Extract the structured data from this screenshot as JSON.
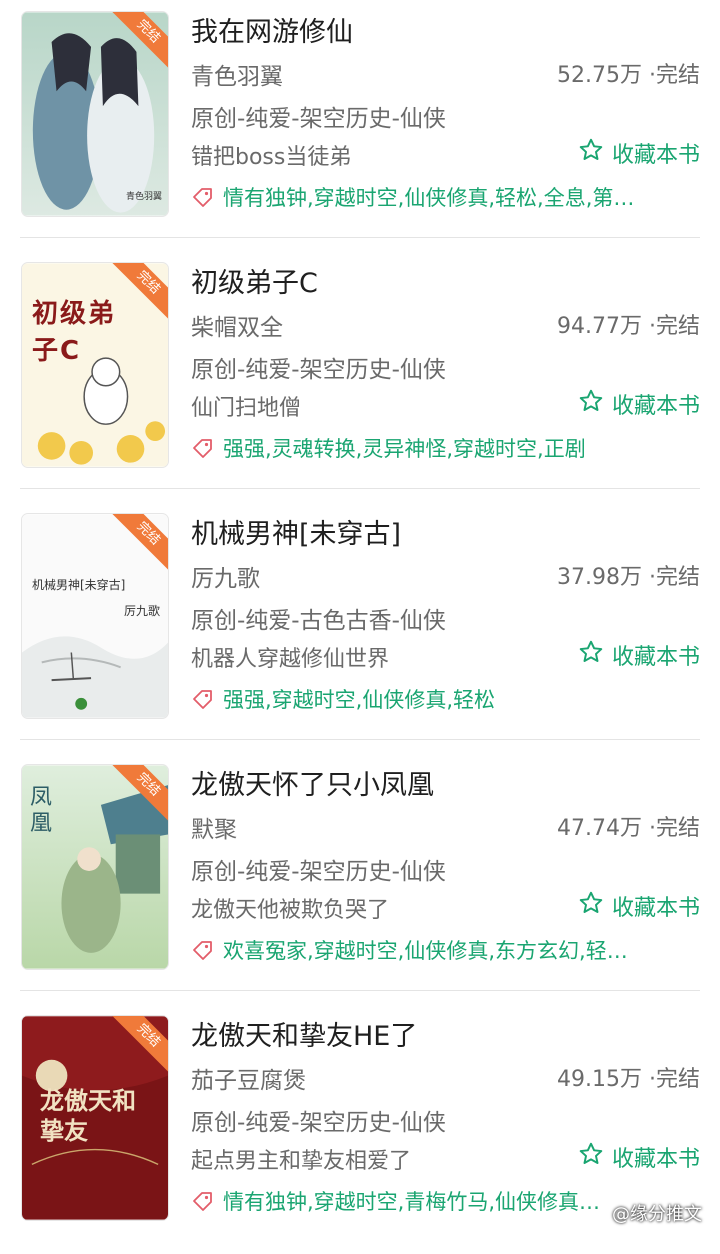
{
  "colors": {
    "accent": "#1aa571",
    "badge": "#f07a3a",
    "text": "#1f1f1f",
    "muted": "#6a6a6a"
  },
  "books": [
    {
      "title": "我在网游修仙",
      "author": "青色羽翼",
      "stats": "52.75万 ·完结",
      "category": "原创-纯爱-架空历史-仙侠",
      "desc": "错把boss当徒弟",
      "fav_label": "收藏本书",
      "tags": "情有独钟,穿越时空,仙侠修真,轻松,全息,第…",
      "cover": {
        "badge": "完结",
        "caption": "青色羽翼"
      }
    },
    {
      "title": "初级弟子C",
      "author": "柴帽双全",
      "stats": "94.77万 ·完结",
      "category": "原创-纯爱-架空历史-仙侠",
      "desc": "仙门扫地僧",
      "fav_label": "收藏本书",
      "tags": "强强,灵魂转换,灵异神怪,穿越时空,正剧",
      "cover": {
        "badge": "完结",
        "caption": "初级弟子C"
      }
    },
    {
      "title": "机械男神[未穿古]",
      "author": "厉九歌",
      "stats": "37.98万 ·完结",
      "category": "原创-纯爱-古色古香-仙侠",
      "desc": "机器人穿越修仙世界",
      "fav_label": "收藏本书",
      "tags": "强强,穿越时空,仙侠修真,轻松",
      "cover": {
        "badge": "完结",
        "caption": "机械男神[未穿古]",
        "caption2": "厉九歌"
      }
    },
    {
      "title": "龙傲天怀了只小凤凰",
      "author": "默聚",
      "stats": "47.74万 ·完结",
      "category": "原创-纯爱-架空历史-仙侠",
      "desc": "龙傲天他被欺负哭了",
      "fav_label": "收藏本书",
      "tags": "欢喜冤家,穿越时空,仙侠修真,东方玄幻,轻…",
      "cover": {
        "badge": "完结",
        "caption": "凤凰"
      }
    },
    {
      "title": "龙傲天和挚友HE了",
      "author": "茄子豆腐煲",
      "stats": "49.15万 ·完结",
      "category": "原创-纯爱-架空历史-仙侠",
      "desc": "起点男主和挚友相爱了",
      "fav_label": "收藏本书",
      "tags": "情有独钟,穿越时空,青梅竹马,仙侠修真…",
      "cover": {
        "badge": "完结",
        "caption": "龙傲天和挚友"
      }
    }
  ],
  "watermark": "@缘分推文"
}
